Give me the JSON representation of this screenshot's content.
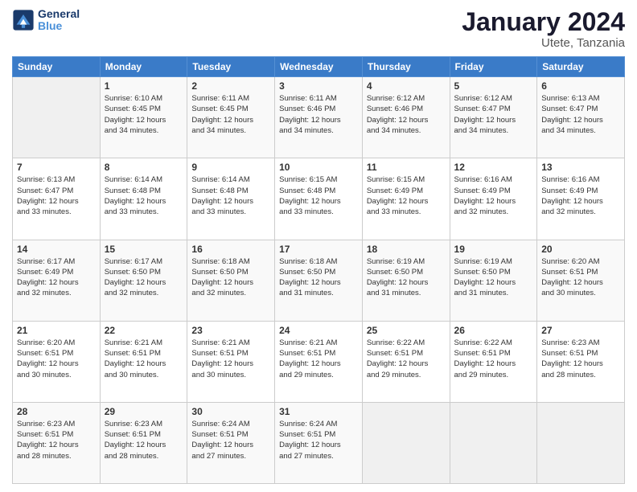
{
  "logo": {
    "line1": "General",
    "line2": "Blue"
  },
  "title": "January 2024",
  "subtitle": "Utete, Tanzania",
  "header_days": [
    "Sunday",
    "Monday",
    "Tuesday",
    "Wednesday",
    "Thursday",
    "Friday",
    "Saturday"
  ],
  "weeks": [
    [
      {
        "day": "",
        "info": ""
      },
      {
        "day": "1",
        "info": "Sunrise: 6:10 AM\nSunset: 6:45 PM\nDaylight: 12 hours\nand 34 minutes."
      },
      {
        "day": "2",
        "info": "Sunrise: 6:11 AM\nSunset: 6:45 PM\nDaylight: 12 hours\nand 34 minutes."
      },
      {
        "day": "3",
        "info": "Sunrise: 6:11 AM\nSunset: 6:46 PM\nDaylight: 12 hours\nand 34 minutes."
      },
      {
        "day": "4",
        "info": "Sunrise: 6:12 AM\nSunset: 6:46 PM\nDaylight: 12 hours\nand 34 minutes."
      },
      {
        "day": "5",
        "info": "Sunrise: 6:12 AM\nSunset: 6:47 PM\nDaylight: 12 hours\nand 34 minutes."
      },
      {
        "day": "6",
        "info": "Sunrise: 6:13 AM\nSunset: 6:47 PM\nDaylight: 12 hours\nand 34 minutes."
      }
    ],
    [
      {
        "day": "7",
        "info": "Sunrise: 6:13 AM\nSunset: 6:47 PM\nDaylight: 12 hours\nand 33 minutes."
      },
      {
        "day": "8",
        "info": "Sunrise: 6:14 AM\nSunset: 6:48 PM\nDaylight: 12 hours\nand 33 minutes."
      },
      {
        "day": "9",
        "info": "Sunrise: 6:14 AM\nSunset: 6:48 PM\nDaylight: 12 hours\nand 33 minutes."
      },
      {
        "day": "10",
        "info": "Sunrise: 6:15 AM\nSunset: 6:48 PM\nDaylight: 12 hours\nand 33 minutes."
      },
      {
        "day": "11",
        "info": "Sunrise: 6:15 AM\nSunset: 6:49 PM\nDaylight: 12 hours\nand 33 minutes."
      },
      {
        "day": "12",
        "info": "Sunrise: 6:16 AM\nSunset: 6:49 PM\nDaylight: 12 hours\nand 32 minutes."
      },
      {
        "day": "13",
        "info": "Sunrise: 6:16 AM\nSunset: 6:49 PM\nDaylight: 12 hours\nand 32 minutes."
      }
    ],
    [
      {
        "day": "14",
        "info": "Sunrise: 6:17 AM\nSunset: 6:49 PM\nDaylight: 12 hours\nand 32 minutes."
      },
      {
        "day": "15",
        "info": "Sunrise: 6:17 AM\nSunset: 6:50 PM\nDaylight: 12 hours\nand 32 minutes."
      },
      {
        "day": "16",
        "info": "Sunrise: 6:18 AM\nSunset: 6:50 PM\nDaylight: 12 hours\nand 32 minutes."
      },
      {
        "day": "17",
        "info": "Sunrise: 6:18 AM\nSunset: 6:50 PM\nDaylight: 12 hours\nand 31 minutes."
      },
      {
        "day": "18",
        "info": "Sunrise: 6:19 AM\nSunset: 6:50 PM\nDaylight: 12 hours\nand 31 minutes."
      },
      {
        "day": "19",
        "info": "Sunrise: 6:19 AM\nSunset: 6:50 PM\nDaylight: 12 hours\nand 31 minutes."
      },
      {
        "day": "20",
        "info": "Sunrise: 6:20 AM\nSunset: 6:51 PM\nDaylight: 12 hours\nand 30 minutes."
      }
    ],
    [
      {
        "day": "21",
        "info": "Sunrise: 6:20 AM\nSunset: 6:51 PM\nDaylight: 12 hours\nand 30 minutes."
      },
      {
        "day": "22",
        "info": "Sunrise: 6:21 AM\nSunset: 6:51 PM\nDaylight: 12 hours\nand 30 minutes."
      },
      {
        "day": "23",
        "info": "Sunrise: 6:21 AM\nSunset: 6:51 PM\nDaylight: 12 hours\nand 30 minutes."
      },
      {
        "day": "24",
        "info": "Sunrise: 6:21 AM\nSunset: 6:51 PM\nDaylight: 12 hours\nand 29 minutes."
      },
      {
        "day": "25",
        "info": "Sunrise: 6:22 AM\nSunset: 6:51 PM\nDaylight: 12 hours\nand 29 minutes."
      },
      {
        "day": "26",
        "info": "Sunrise: 6:22 AM\nSunset: 6:51 PM\nDaylight: 12 hours\nand 29 minutes."
      },
      {
        "day": "27",
        "info": "Sunrise: 6:23 AM\nSunset: 6:51 PM\nDaylight: 12 hours\nand 28 minutes."
      }
    ],
    [
      {
        "day": "28",
        "info": "Sunrise: 6:23 AM\nSunset: 6:51 PM\nDaylight: 12 hours\nand 28 minutes."
      },
      {
        "day": "29",
        "info": "Sunrise: 6:23 AM\nSunset: 6:51 PM\nDaylight: 12 hours\nand 28 minutes."
      },
      {
        "day": "30",
        "info": "Sunrise: 6:24 AM\nSunset: 6:51 PM\nDaylight: 12 hours\nand 27 minutes."
      },
      {
        "day": "31",
        "info": "Sunrise: 6:24 AM\nSunset: 6:51 PM\nDaylight: 12 hours\nand 27 minutes."
      },
      {
        "day": "",
        "info": ""
      },
      {
        "day": "",
        "info": ""
      },
      {
        "day": "",
        "info": ""
      }
    ]
  ]
}
